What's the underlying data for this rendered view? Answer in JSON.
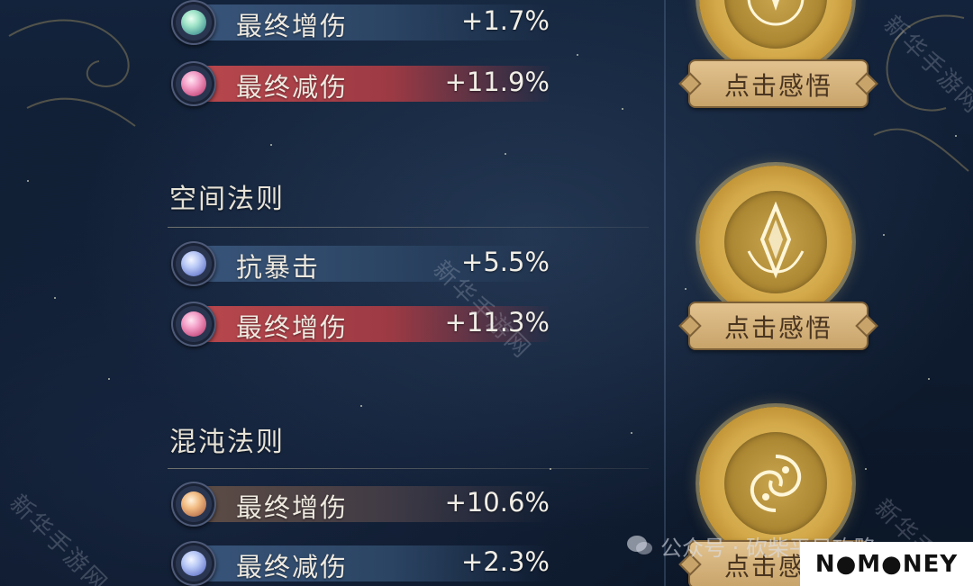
{
  "sections": [
    {
      "title": "",
      "stats": [
        {
          "name": "最终增伤",
          "value": "+1.7%",
          "gem": "green",
          "bar": "blue"
        },
        {
          "name": "最终减伤",
          "value": "+11.9%",
          "gem": "pink",
          "bar": "red"
        }
      ],
      "button": "点击感悟",
      "emblem_icon": "orb-star-icon"
    },
    {
      "title": "空间法则",
      "stats": [
        {
          "name": "抗暴击",
          "value": "+5.5%",
          "gem": "blue",
          "bar": "blue"
        },
        {
          "name": "最终增伤",
          "value": "+11.3%",
          "gem": "pink",
          "bar": "red"
        }
      ],
      "button": "点击感悟",
      "emblem_icon": "crystal-icon"
    },
    {
      "title": "混沌法则",
      "stats": [
        {
          "name": "最终增伤",
          "value": "+10.6%",
          "gem": "orange",
          "bar": "amber"
        },
        {
          "name": "最终减伤",
          "value": "+2.3%",
          "gem": "blue",
          "bar": "blue"
        }
      ],
      "button": "点击感悟",
      "emblem_icon": "swirl-icon"
    }
  ],
  "watermark_text": "新华手游网",
  "wechat_text": "公众号 · 砍柴平日攻略",
  "brand_text": "N●M●NEY",
  "colors": {
    "gold": "#d3a94a",
    "red_bar": "#b8474d",
    "blue_bar": "#385479"
  }
}
